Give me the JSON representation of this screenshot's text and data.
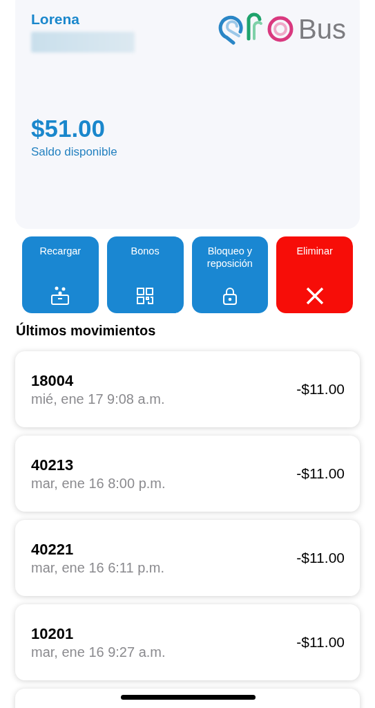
{
  "account": {
    "name": "Lorena",
    "balance": "$51.00",
    "balance_label": "Saldo disponible"
  },
  "logo": {
    "text": "Bus"
  },
  "actions": [
    {
      "label": "Recargar",
      "kind": "recharge"
    },
    {
      "label": "Bonos",
      "kind": "qr"
    },
    {
      "label": "Bloqueo y reposición",
      "kind": "lock"
    },
    {
      "label": "Eliminar",
      "kind": "delete"
    }
  ],
  "movements_title": "Últimos movimientos",
  "movements": [
    {
      "route": "18004",
      "date": "mié, ene 17 9:08 a.m.",
      "amount": "-$11.00"
    },
    {
      "route": "40213",
      "date": "mar, ene 16 8:00 p.m.",
      "amount": "-$11.00"
    },
    {
      "route": "40221",
      "date": "mar, ene 16 6:11 p.m.",
      "amount": "-$11.00"
    },
    {
      "route": "10201",
      "date": "mar, ene 16 9:27 a.m.",
      "amount": "-$11.00"
    }
  ]
}
